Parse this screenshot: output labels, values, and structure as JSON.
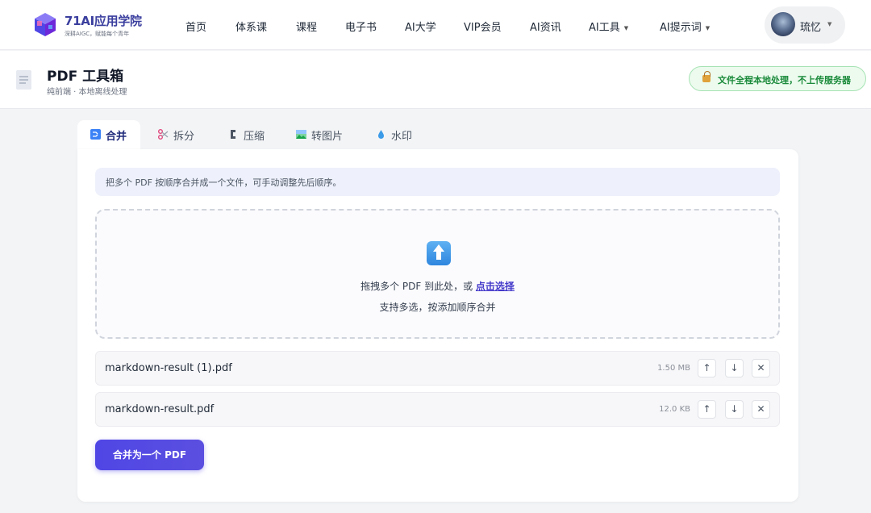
{
  "brand": {
    "title": "71AI应用学院",
    "subtitle": "深耕AIGC，赋能每个青年"
  },
  "nav": {
    "items": [
      {
        "label": "首页"
      },
      {
        "label": "体系课"
      },
      {
        "label": "课程"
      },
      {
        "label": "电子书"
      },
      {
        "label": "AI大学"
      },
      {
        "label": "VIP会员"
      },
      {
        "label": "AI资讯"
      },
      {
        "label": "AI工具",
        "caret": "▼"
      },
      {
        "label": "AI提示词",
        "caret": "▼"
      }
    ]
  },
  "user": {
    "name": "琉忆",
    "caret": "▼"
  },
  "page": {
    "title": "PDF 工具箱",
    "subtitle": "纯前端 · 本地离线处理",
    "badge": "文件全程本地处理，不上传服务器"
  },
  "tabs": [
    {
      "label": "合并",
      "icon": "merge-icon",
      "active": true
    },
    {
      "label": "拆分",
      "icon": "scissors-icon"
    },
    {
      "label": "压缩",
      "icon": "clamp-icon"
    },
    {
      "label": "转图片",
      "icon": "picture-icon"
    },
    {
      "label": "水印",
      "icon": "droplet-icon"
    }
  ],
  "merge": {
    "hint": "把多个 PDF 按顺序合并成一个文件，可手动调整先后顺序。",
    "drop_text": "拖拽多个 PDF 到此处，或",
    "drop_link": "点击选择",
    "drop_sub": "支持多选，按添加顺序合并",
    "files": [
      {
        "name": "markdown-result (1).pdf",
        "size": "1.50 MB"
      },
      {
        "name": "markdown-result.pdf",
        "size": "12.0 KB"
      }
    ],
    "row_controls": {
      "up": "↑",
      "down": "↓",
      "remove": "✕"
    },
    "submit_label": "合并为一个 PDF"
  },
  "colors": {
    "accent": "#4f46e5",
    "badge_green": "#1a8a3a",
    "brand": "#3b3f9e"
  }
}
